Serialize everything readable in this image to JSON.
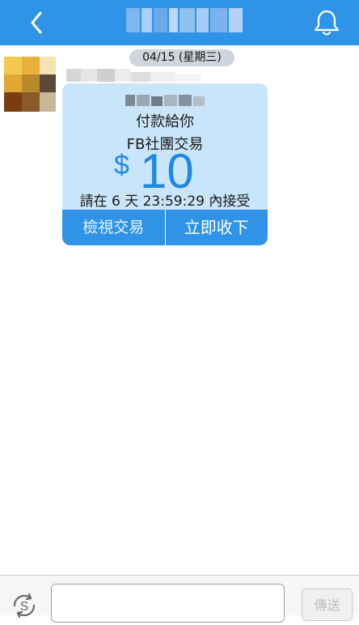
{
  "header": {
    "back_icon": "chevron-left-icon",
    "bell_icon": "bell-icon",
    "bg_color": "#2f93e8"
  },
  "chat": {
    "date_label": "04/15 (星期三)"
  },
  "payment_card": {
    "line1": "付款給你",
    "line2": "FB社團交易",
    "currency_symbol": "$",
    "amount": "10",
    "deadline": "請在 6 天 23:59:29 內接受",
    "view_label": "檢視交易",
    "accept_label": "立即收下",
    "accent_color": "#1e88e5",
    "card_bg": "#c9e5fa"
  },
  "composer": {
    "pay_icon": "dollar-circle-icon",
    "input_value": "",
    "send_label": "傳送"
  }
}
